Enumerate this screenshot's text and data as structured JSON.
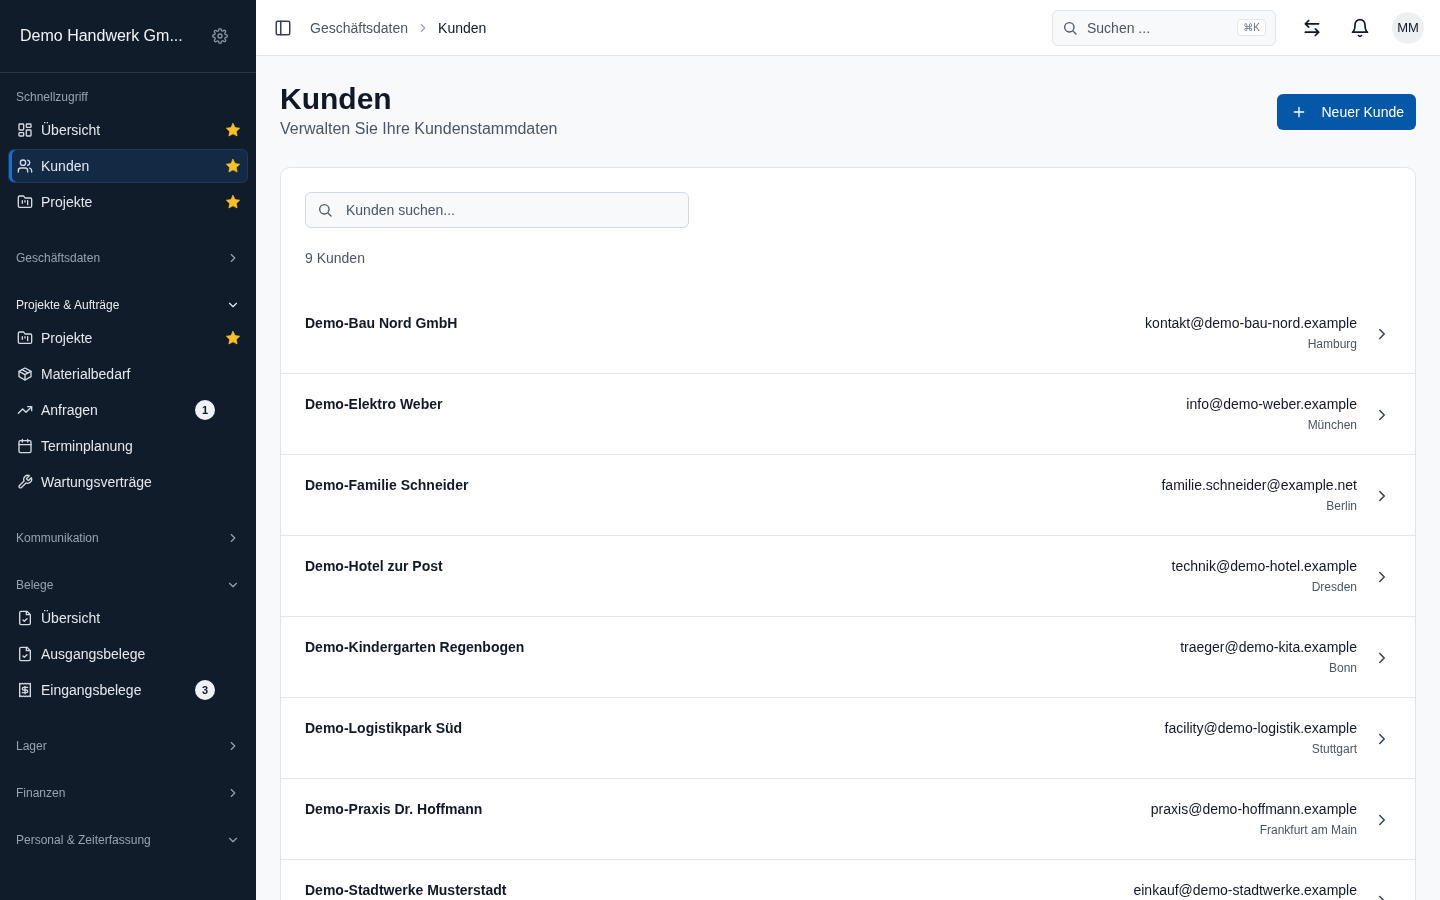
{
  "sidebar": {
    "company": "Demo Handwerk Gm...",
    "groups": [
      {
        "kind": "plain",
        "label": "Schnellzugriff",
        "items": [
          {
            "kind": "grid",
            "label": "Übersicht",
            "starred": true,
            "selected": false
          },
          {
            "kind": "users",
            "label": "Kunden",
            "starred": true,
            "selected": true
          },
          {
            "kind": "folder",
            "label": "Projekte",
            "starred": true,
            "selected": false
          }
        ]
      },
      {
        "kind": "collapsible",
        "label": "Geschäftsdaten",
        "active": false,
        "expanded": false
      },
      {
        "kind": "collapsible",
        "label": "Projekte & Aufträge",
        "active": true,
        "expanded": true,
        "items": [
          {
            "kind": "folder",
            "label": "Projekte",
            "starred": true,
            "selected": false
          },
          {
            "kind": "box",
            "label": "Materialbedarf",
            "starred": false,
            "selected": false
          },
          {
            "kind": "trend",
            "label": "Anfragen",
            "starred": false,
            "selected": false,
            "badge": "1"
          },
          {
            "kind": "calendar",
            "label": "Terminplanung",
            "starred": false,
            "selected": false
          },
          {
            "kind": "wrench",
            "label": "Wartungsverträge",
            "starred": false,
            "selected": false
          }
        ]
      },
      {
        "kind": "collapsible",
        "label": "Kommunikation",
        "active": false,
        "expanded": false
      },
      {
        "kind": "collapsible",
        "label": "Belege",
        "active": false,
        "expanded": true,
        "items": [
          {
            "kind": "filecheck",
            "label": "Übersicht",
            "starred": false,
            "selected": false
          },
          {
            "kind": "filecheck",
            "label": "Ausgangsbelege",
            "starred": false,
            "selected": false
          },
          {
            "kind": "receipt",
            "label": "Eingangsbelege",
            "starred": false,
            "selected": false,
            "badge": "3"
          }
        ]
      },
      {
        "kind": "collapsible",
        "label": "Lager",
        "active": false,
        "expanded": false
      },
      {
        "kind": "collapsible",
        "label": "Finanzen",
        "active": false,
        "expanded": false
      },
      {
        "kind": "collapsible",
        "label": "Personal & Zeiterfassung",
        "active": false,
        "expanded": true
      }
    ]
  },
  "topbar": {
    "breadcrumb": [
      "Geschäftsdaten",
      "Kunden"
    ],
    "search": {
      "placeholder": "Suchen ...",
      "shortcut": "⌘K"
    },
    "avatar": "MM"
  },
  "page": {
    "title": "Kunden",
    "subtitle": "Verwalten Sie Ihre Kundenstammdaten",
    "new_button": "Neuer Kunde"
  },
  "list": {
    "search": {
      "placeholder": "Kunden suchen..."
    },
    "count": "9 Kunden",
    "customers": [
      {
        "name": "Demo-Bau Nord GmbH",
        "email": "kontakt@demo-bau-nord.example",
        "city": "Hamburg"
      },
      {
        "name": "Demo-Elektro Weber",
        "email": "info@demo-weber.example",
        "city": "München"
      },
      {
        "name": "Demo-Familie Schneider",
        "email": "familie.schneider@example.net",
        "city": "Berlin"
      },
      {
        "name": "Demo-Hotel zur Post",
        "email": "technik@demo-hotel.example",
        "city": "Dresden"
      },
      {
        "name": "Demo-Kindergarten Regenbogen",
        "email": "traeger@demo-kita.example",
        "city": "Bonn"
      },
      {
        "name": "Demo-Logistikpark Süd",
        "email": "facility@demo-logistik.example",
        "city": "Stuttgart"
      },
      {
        "name": "Demo-Praxis Dr. Hoffmann",
        "email": "praxis@demo-hoffmann.example",
        "city": "Frankfurt am Main"
      },
      {
        "name": "Demo-Stadtwerke Musterstadt",
        "email": "einkauf@demo-stadtwerke.example"
      }
    ]
  }
}
